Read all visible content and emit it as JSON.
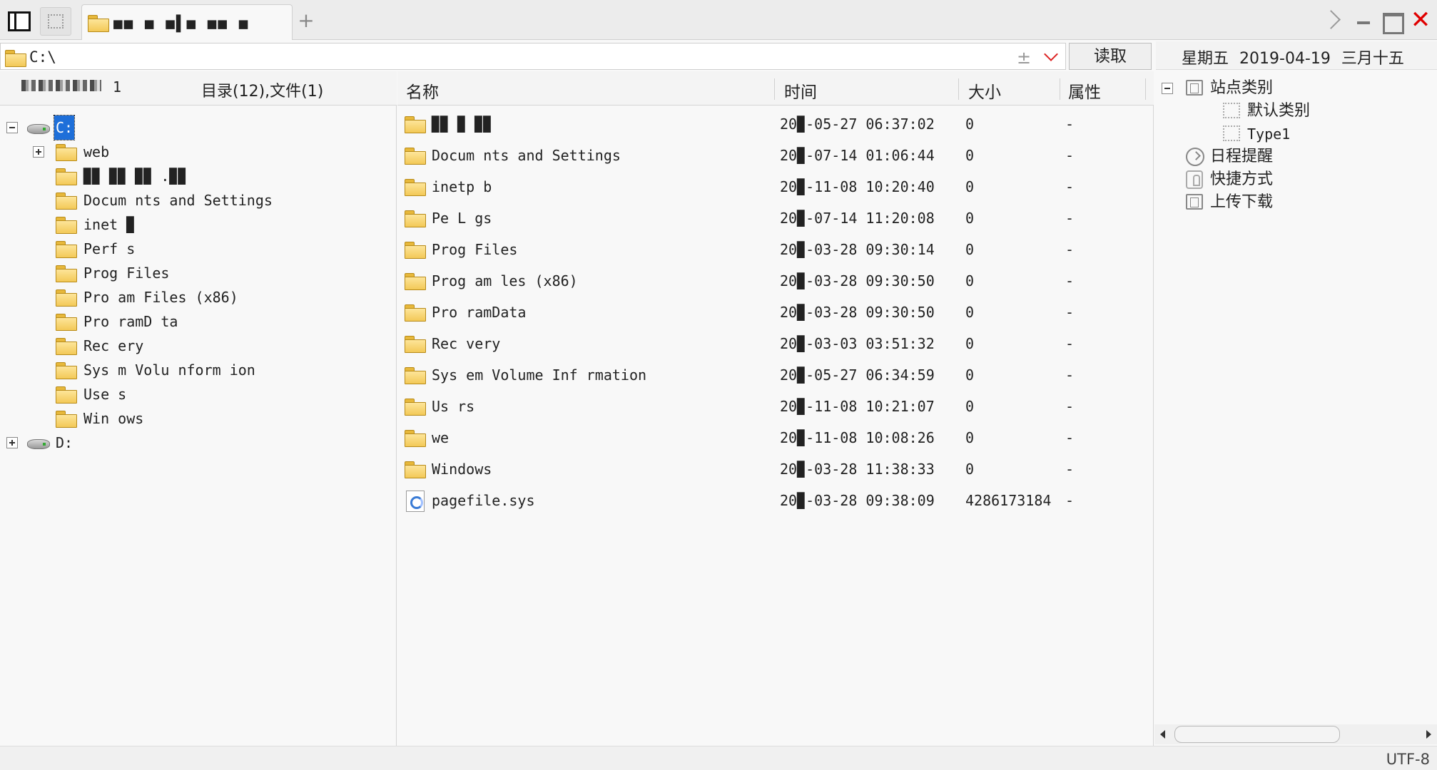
{
  "window": {
    "tab_title": "■■ ■ ■▌■ ■■  ■",
    "tab_add_label": "+",
    "close_label": "✕"
  },
  "address": {
    "path": "C:\\",
    "plus_label": "±",
    "read_button": "读取"
  },
  "calendar": {
    "weekday": "星期五",
    "date": "2019-04-19",
    "lunar": "三月十五"
  },
  "left_panel": {
    "header_suffix": "1",
    "summary": "目录(12),文件(1)",
    "tree": {
      "drive_c": "C:",
      "drive_d": "D:",
      "folders": [
        "web",
        "▉▉ ▉▉ ▉▉ .▉▉",
        "Docum nts and Settings",
        "inet ▉",
        "Perf  s",
        "Prog  Files",
        "Pro  am Files (x86)",
        "Pro ramD ta",
        "Rec  ery",
        "Sys  m Volu  nform  ion",
        "Use s",
        "Win ows"
      ]
    }
  },
  "file_list": {
    "columns": {
      "name": "名称",
      "time": "时间",
      "size": "大小",
      "attr": "属性"
    },
    "rows": [
      {
        "name": "▉▉ ▉ ▉▉",
        "time": "20▉-05-27 06:37:02",
        "size": "0",
        "attr": "-",
        "kind": "folder"
      },
      {
        "name": "Docum nts and Settings",
        "time": "20▉-07-14 01:06:44",
        "size": "0",
        "attr": "-",
        "kind": "folder"
      },
      {
        "name": "inetp b",
        "time": "20▉-11-08 10:20:40",
        "size": "0",
        "attr": "-",
        "kind": "folder"
      },
      {
        "name": "Pe  L gs",
        "time": "20▉-07-14 11:20:08",
        "size": "0",
        "attr": "-",
        "kind": "folder"
      },
      {
        "name": "Prog  Files",
        "time": "20▉-03-28 09:30:14",
        "size": "0",
        "attr": "-",
        "kind": "folder"
      },
      {
        "name": "Prog am  les (x86)",
        "time": "20▉-03-28 09:30:50",
        "size": "0",
        "attr": "-",
        "kind": "folder"
      },
      {
        "name": "Pro ramData",
        "time": "20▉-03-28 09:30:50",
        "size": "0",
        "attr": "-",
        "kind": "folder"
      },
      {
        "name": "Rec very",
        "time": "20▉-03-03 03:51:32",
        "size": "0",
        "attr": "-",
        "kind": "folder"
      },
      {
        "name": "Sys em Volume Inf rmation",
        "time": "20▉-05-27 06:34:59",
        "size": "0",
        "attr": "-",
        "kind": "folder"
      },
      {
        "name": "Us rs",
        "time": "20▉-11-08 10:21:07",
        "size": "0",
        "attr": "-",
        "kind": "folder"
      },
      {
        "name": "we",
        "time": "20▉-11-08 10:08:26",
        "size": "0",
        "attr": "-",
        "kind": "folder"
      },
      {
        "name": "Windows",
        "time": "20▉-03-28 11:38:33",
        "size": "0",
        "attr": "-",
        "kind": "folder"
      },
      {
        "name": "pagefile.sys",
        "time": "20▉-03-28 09:38:09",
        "size": "4286173184",
        "attr": "-",
        "kind": "file"
      }
    ]
  },
  "site_panel": {
    "root": "站点类别",
    "default_category": "默认类别",
    "type1": "Type1",
    "schedule": "日程提醒",
    "shortcuts": "快捷方式",
    "transfer": "上传下载"
  },
  "status": {
    "encoding": "UTF-8"
  },
  "colors": {
    "selection": "#1e6fd9",
    "close": "#e00000",
    "folder": "#f3c957"
  }
}
